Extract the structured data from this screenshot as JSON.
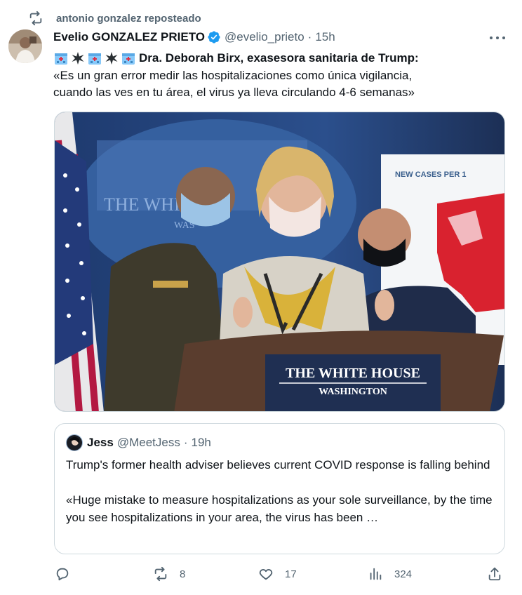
{
  "repost": {
    "icon": "repost-icon",
    "text": "antonio gonzalez reposteado"
  },
  "tweet": {
    "author_name": "Evelio GONZALEZ PRIETO",
    "verified_icon": "verified-badge-icon",
    "handle": "@evelio_prieto",
    "separator": "·",
    "time": "15h",
    "more_icon": "more-options-icon",
    "headline_emojis": [
      "hospital-emoji",
      "sparkle-emoji",
      "hospital-emoji",
      "sparkle-emoji",
      "hospital-emoji"
    ],
    "headline": "Dra. Deborah Birx, exasesora sanitaria de Trump:",
    "body_line1": "«Es un gran error medir las hospitalizaciones como única vigilancia,",
    "body_line2": "cuando  las ves en tu área, el virus ya lleva circulando 4-6 semanas»",
    "image": {
      "podium_line1": "THE WHITE HOUSE",
      "podium_line2": "WASHINGTON",
      "seal_text": "THE WHITE HO",
      "seal_text2": "WAS",
      "map_title": "NEW CASES PER 1"
    }
  },
  "quote": {
    "author_name": "Jess",
    "handle": "@MeetJess",
    "separator": "·",
    "time": "19h",
    "paragraph1": "Trump's former health adviser believes current COVID response is falling behind",
    "paragraph2": "«Huge mistake to measure hospitalizations as your sole surveillance, by the time you see hospitalizations in your area, the virus has been …"
  },
  "actions": {
    "reply": {
      "icon": "reply-icon",
      "count": ""
    },
    "repost": {
      "icon": "repost-icon",
      "count": "8"
    },
    "like": {
      "icon": "heart-icon",
      "count": "17"
    },
    "views": {
      "icon": "views-chart-icon",
      "count": "324"
    },
    "share": {
      "icon": "share-icon",
      "count": ""
    }
  },
  "colors": {
    "text_primary": "#0f1419",
    "text_secondary": "#536471",
    "verified_blue": "#1d9bf0",
    "border": "#cfd9de"
  }
}
